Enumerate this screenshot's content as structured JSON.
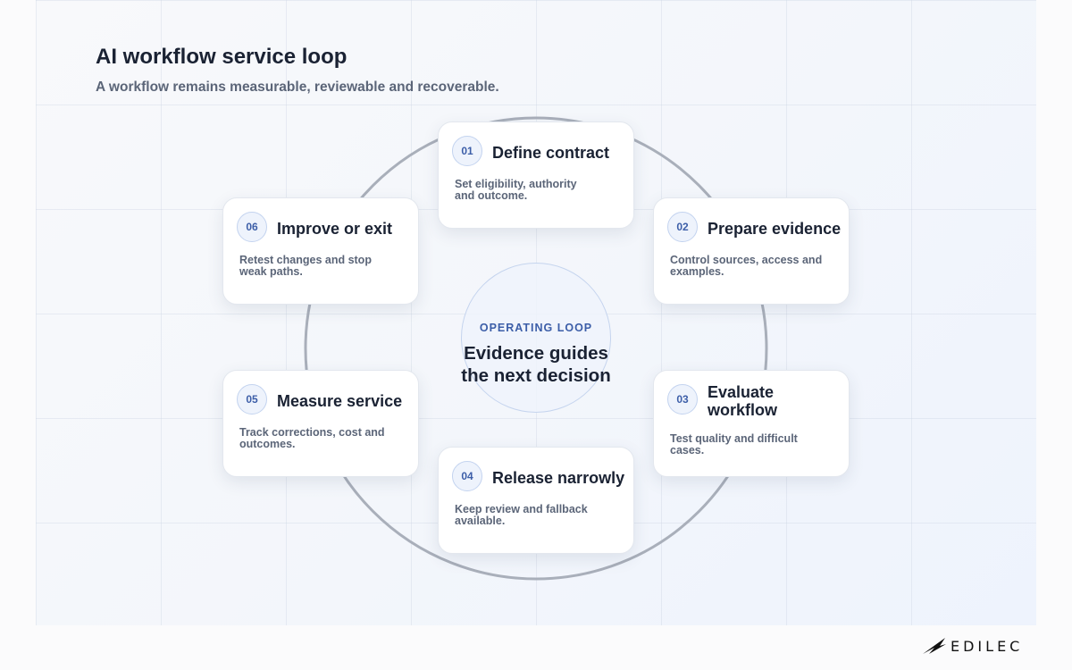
{
  "header": {
    "title": "AI workflow service loop",
    "subtitle": "A workflow remains measurable, reviewable and recoverable."
  },
  "center": {
    "eyebrow": "OPERATING LOOP",
    "headline_line1": "Evidence guides",
    "headline_line2": "the next decision"
  },
  "steps": [
    {
      "number": "01",
      "title": "Define contract",
      "desc_line1": "Set eligibility, authority",
      "desc_line2": "and outcome."
    },
    {
      "number": "02",
      "title": "Prepare evidence",
      "desc_line1": "Control sources, access and",
      "desc_line2": "examples."
    },
    {
      "number": "03",
      "title_line1": "Evaluate",
      "title_line2": "workflow",
      "desc_line1": "Test quality and difficult",
      "desc_line2": "cases."
    },
    {
      "number": "04",
      "title": "Release narrowly",
      "desc_line1": "Keep review and fallback",
      "desc_line2": "available."
    },
    {
      "number": "05",
      "title": "Measure service",
      "desc_line1": "Track corrections, cost and",
      "desc_line2": "outcomes."
    },
    {
      "number": "06",
      "title": "Improve or exit",
      "desc_line1": "Retest changes and stop",
      "desc_line2": "weak paths."
    }
  ],
  "brand": {
    "logo_text": "EDILEC"
  },
  "colors": {
    "accent": "#3c5ea8",
    "loop_ring": "#a9afba",
    "title_text": "#1a2233",
    "muted_text": "#5b6578"
  },
  "icons": {
    "brand_mark": "edilec-logo-mark-icon"
  }
}
